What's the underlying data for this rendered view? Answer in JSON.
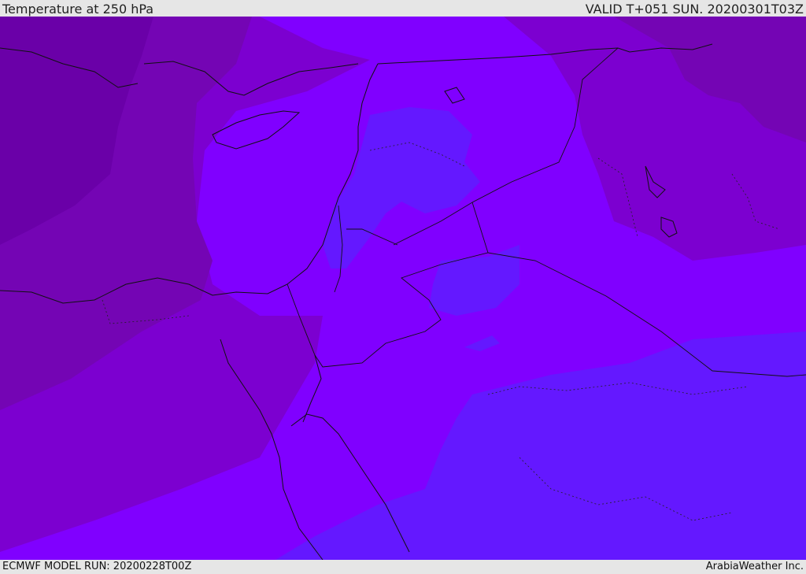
{
  "header": {
    "title": "Temperature at 250 hPa",
    "valid": "VALID T+051 SUN. 20200301T03Z"
  },
  "footer": {
    "model_run": "ECMWF MODEL RUN: 20200228T00Z",
    "credit": "ArabiaWeather Inc."
  },
  "colors": {
    "band_coldest": "#6a00a8",
    "band_cold": "#7405b4",
    "band_mid": "#7c00d0",
    "band_warm": "#8000ff",
    "band_warmest": "#6418ff",
    "coastline": "#111111",
    "header_bg": "#e6e6e6"
  }
}
